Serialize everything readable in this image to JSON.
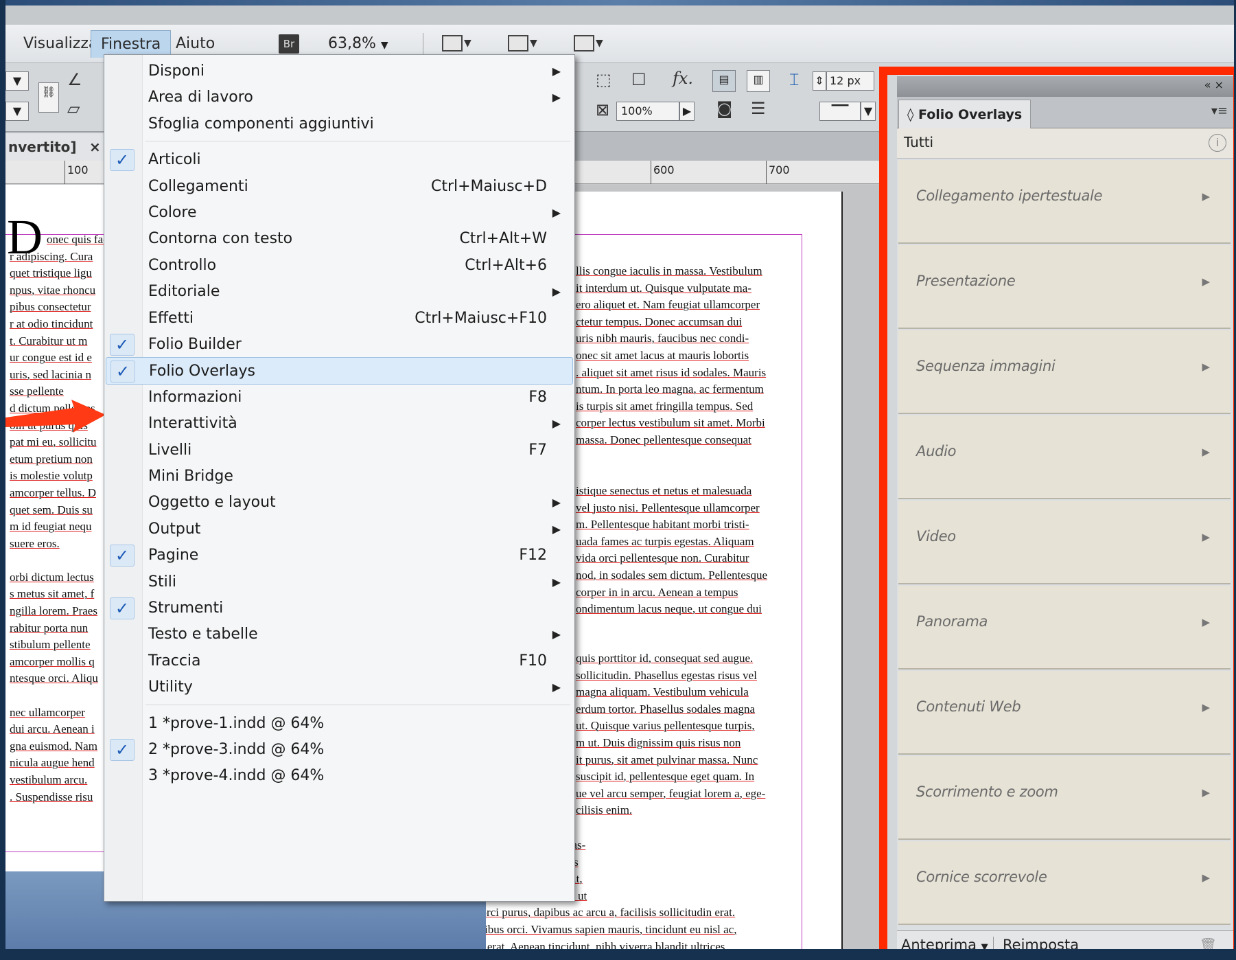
{
  "menubar": {
    "items": [
      "Visualizza",
      "Finestra",
      "Aiuto"
    ],
    "bridge": "Br",
    "zoom": "63,8%"
  },
  "control": {
    "size_field": "12 px",
    "opacity_field": "100%",
    "fx": "fx."
  },
  "document": {
    "tab_label": "nvertito]",
    "tab_close": "×",
    "ruler": [
      "100",
      "600",
      "700"
    ],
    "left_column": [
      "onec quis fac",
      "r adipiscing. Cura",
      "quet tristique ligu",
      "npus, vitae rhoncu",
      "pibus consectetur",
      "r at odio tincidunt",
      "t. Curabitur ut m",
      "ur congue est id e",
      "uris, sed lacinia n",
      "sse pellente",
      "d dictum pellentes",
      "oin ut purus quis",
      "pat mi eu, sollicitu",
      "etum pretium non",
      "is molestie volutp",
      "amcorper tellus. D",
      "quet sem. Duis su",
      "m id feugiat nequ",
      "suere eros.",
      "",
      "orbi dictum lectus",
      "s metus sit amet, f",
      "ngilla lorem. Praes",
      "rabitur porta nun",
      "stibulum pellente",
      "amcorper mollis q",
      "ntesque orci. Aliqu",
      "",
      "nec ullamcorper",
      "dui arcu. Aenean i",
      "gna euismod. Nam",
      "nicula augue hend",
      " vestibulum arcu.",
      ". Suspendisse risu"
    ],
    "right_block_1": [
      "llis congue iaculis in massa. Vestibulum",
      "it interdum ut. Quisque vulputate ma-",
      "ero aliquet et. Nam feugiat ullamcorper",
      "ctetur tempus. Donec accumsan dui",
      "uris nibh mauris, faucibus nec condi-",
      "onec sit amet lacus at mauris lobortis",
      ". aliquet sit amet risus id sodales. Mauris",
      "ntum. In porta leo magna, ac fermentum",
      "is turpis sit amet fringilla tempus. Sed",
      "corper lectus vestibulum sit amet. Morbi",
      " massa. Donec pellentesque consequat"
    ],
    "right_block_2": [
      "istique senectus et netus et malesuada",
      "vel justo nisi. Pellentesque ullamcorper",
      "m. Pellentesque habitant morbi tristi-",
      "uada fames ac turpis egestas. Aliquam",
      "vida orci pellentesque non. Curabitur",
      "nod, in sodales sem dictum. Pellentesque",
      "corper in in arcu. Aenean a tempus",
      "ondimentum lacus neque, ut congue dui"
    ],
    "right_block_3": [
      "quis porttitor id, consequat sed augue.",
      "sollicitudin. Phasellus egestas risus vel",
      " magna aliquam. Vestibulum vehicula",
      "erdum tortor. Phasellus sodales magna",
      "ut. Quisque varius pellentesque turpis,",
      "m ut. Duis dignissim quis risus non",
      "it purus, sit amet pulvinar massa. Nunc",
      " suscipit id, pellentesque eget quam. In",
      "ue vel arcu semper, feugiat lorem a, ege-",
      "cilisis enim."
    ],
    "right_block_4": [
      "drerit aliquet a nec magna. Sed et mas-",
      "uis mi. Vestibulum ante ipsum primis",
      "es posuere cubilia Curae; In hendrerit,",
      "ibh laoreet lacus, ut cursus orci nunc ut",
      "turpis. Vivamus orci purus, dapibus ac arcu a, facilisis sollicitudin erat.",
      "Quisque sed faucibus orci. Vivamus sapien mauris, tincidunt eu nisl ac,",
      "molestie ultricies erat. Aenean tincidunt, nibh viverra blandit ultrices,"
    ]
  },
  "menu": {
    "items": [
      {
        "label": "Disponi",
        "shortcut": "",
        "submenu": true,
        "checked": false
      },
      {
        "label": "Area di lavoro",
        "shortcut": "",
        "submenu": true,
        "checked": false
      },
      {
        "label": "Sfoglia componenti aggiuntivi",
        "shortcut": "",
        "submenu": false,
        "checked": false
      },
      {
        "label": "Articoli",
        "shortcut": "",
        "submenu": false,
        "checked": true
      },
      {
        "label": "Collegamenti",
        "shortcut": "Ctrl+Maiusc+D",
        "submenu": false,
        "checked": false
      },
      {
        "label": "Colore",
        "shortcut": "",
        "submenu": true,
        "checked": false
      },
      {
        "label": "Contorna con testo",
        "shortcut": "Ctrl+Alt+W",
        "submenu": false,
        "checked": false
      },
      {
        "label": "Controllo",
        "shortcut": "Ctrl+Alt+6",
        "submenu": false,
        "checked": false
      },
      {
        "label": "Editoriale",
        "shortcut": "",
        "submenu": true,
        "checked": false
      },
      {
        "label": "Effetti",
        "shortcut": "Ctrl+Maiusc+F10",
        "submenu": false,
        "checked": false
      },
      {
        "label": "Folio Builder",
        "shortcut": "",
        "submenu": false,
        "checked": true
      },
      {
        "label": "Folio Overlays",
        "shortcut": "",
        "submenu": false,
        "checked": true,
        "highlighted": true
      },
      {
        "label": "Informazioni",
        "shortcut": "F8",
        "submenu": false,
        "checked": false
      },
      {
        "label": "Interattività",
        "shortcut": "",
        "submenu": true,
        "checked": false
      },
      {
        "label": "Livelli",
        "shortcut": "F7",
        "submenu": false,
        "checked": false
      },
      {
        "label": "Mini Bridge",
        "shortcut": "",
        "submenu": false,
        "checked": false
      },
      {
        "label": "Oggetto e layout",
        "shortcut": "",
        "submenu": true,
        "checked": false
      },
      {
        "label": "Output",
        "shortcut": "",
        "submenu": true,
        "checked": false
      },
      {
        "label": "Pagine",
        "shortcut": "F12",
        "submenu": false,
        "checked": true
      },
      {
        "label": "Stili",
        "shortcut": "",
        "submenu": true,
        "checked": false
      },
      {
        "label": "Strumenti",
        "shortcut": "",
        "submenu": false,
        "checked": true
      },
      {
        "label": "Testo e tabelle",
        "shortcut": "",
        "submenu": true,
        "checked": false
      },
      {
        "label": "Traccia",
        "shortcut": "F10",
        "submenu": false,
        "checked": false
      },
      {
        "label": "Utility",
        "shortcut": "",
        "submenu": true,
        "checked": false
      },
      {
        "label": "1 *prove-1.indd @ 64%",
        "shortcut": "",
        "submenu": false,
        "checked": false
      },
      {
        "label": "2 *prove-3.indd @ 64%",
        "shortcut": "",
        "submenu": false,
        "checked": true
      },
      {
        "label": "3 *prove-4.indd @ 64%",
        "shortcut": "",
        "submenu": false,
        "checked": false
      }
    ]
  },
  "panel": {
    "title": "Folio Overlays",
    "collapse": "«  ×",
    "filter": "Tutti",
    "overlays": [
      "Collegamento ipertestuale",
      "Presentazione",
      "Sequenza immagini",
      "Audio",
      "Video",
      "Panorama",
      "Contenuti Web",
      "Scorrimento e zoom",
      "Cornice scorrevole"
    ],
    "preview_label": "Anteprima",
    "reset_label": "Reimposta"
  },
  "colors": {
    "highlight_frame": "#ff2a00",
    "check_blue": "#1d5bb6",
    "menu_highlight": "#dcebf9"
  }
}
